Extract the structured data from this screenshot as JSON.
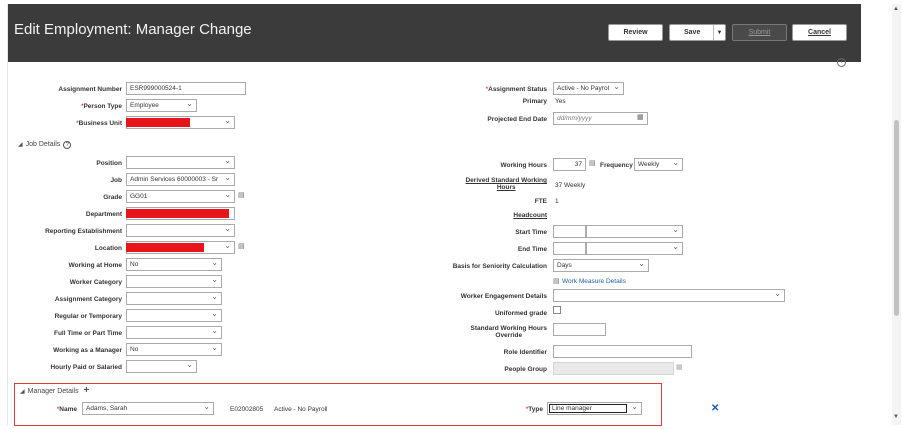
{
  "page": {
    "title": "Edit Employment: Manager Change",
    "buttons": {
      "review": "Review",
      "save": "Save",
      "submit": "Submit",
      "cancel": "Cancel"
    },
    "help": "?"
  },
  "assignment": {
    "assignment_number_label": "Assignment Number",
    "assignment_number": "ESR999000524-1",
    "person_type_label": "Person Type",
    "person_type": "Employee",
    "business_unit_label": "Business Unit",
    "assignment_status_label": "Assignment Status",
    "assignment_status": "Active - No Payrol",
    "primary_label": "Primary",
    "primary": "Yes",
    "projected_end_date_label": "Projected End Date",
    "projected_end_date_placeholder": "dd/mm/yyyy"
  },
  "job_details": {
    "section_label": "Job Details",
    "position_label": "Position",
    "job_label": "Job",
    "job": "Admin Services 60000003 - Sr",
    "grade_label": "Grade",
    "grade": "GG01",
    "department_label": "Department",
    "reporting_establishment_label": "Reporting Establishment",
    "location_label": "Location",
    "working_at_home_label": "Working at Home",
    "working_at_home": "No",
    "worker_category_label": "Worker Category",
    "assignment_category_label": "Assignment Category",
    "regular_or_temporary_label": "Regular or Temporary",
    "full_or_part_time_label": "Full Time or Part Time",
    "working_as_manager_label": "Working as a Manager",
    "working_as_manager": "No",
    "hourly_paid_label": "Hourly Paid or Salaried",
    "working_hours_label": "Working Hours",
    "working_hours": "37",
    "frequency_label": "Frequency",
    "frequency": "Weekly",
    "derived_hours_label_1": "Derived Standard Working",
    "derived_hours_label_2": "Hours",
    "derived_hours": "37 Weekly",
    "fte_label": "FTE",
    "fte": "1",
    "headcount_label": "Headcount",
    "start_time_label": "Start Time",
    "end_time_label": "End Time",
    "seniority_label": "Basis for Seniority Calculation",
    "seniority": "Days",
    "work_measure_link": "Work Measure Details",
    "engagement_label": "Worker Engagement Details",
    "uniformed_grade_label": "Uniformed grade",
    "override_label_1": "Standard Working Hours",
    "override_label_2": "Override",
    "role_identifier_label": "Role Identifier",
    "people_group_label": "People Group"
  },
  "manager": {
    "section_label": "Manager Details",
    "name_label": "Name",
    "name": "Adams, Sarah",
    "number": "E02002805",
    "status": "Active - No Payroll",
    "type_label": "Type",
    "type": "Line manager"
  }
}
